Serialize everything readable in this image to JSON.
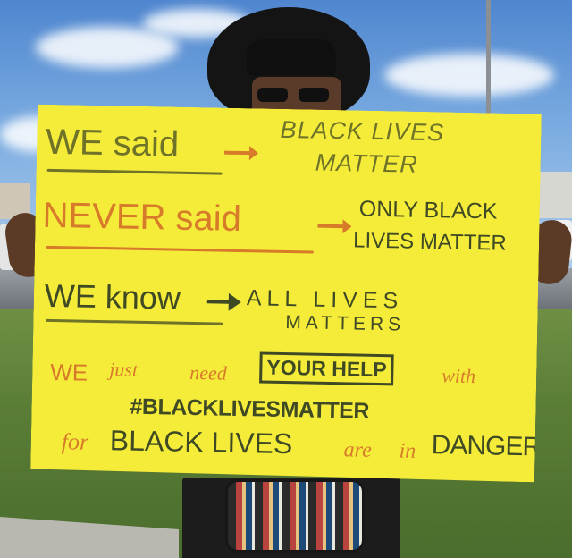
{
  "sign": {
    "line1_left": "WE said",
    "line1_right_1": "BLACK LIVES",
    "line1_right_2": "MATTER",
    "line2_left": "NEVER said",
    "line2_right_1": "ONLY BLACK",
    "line2_right_2": "LIVES MATTER",
    "line3_left": "WE know",
    "line3_right_1": "ALL LIVES",
    "line3_right_2": "MATTERS",
    "line4_a": "WE",
    "line4_b": "just",
    "line4_c": "need",
    "line4_help": "YOUR HELP",
    "line4_d": "with",
    "line5": "#BLACKLIVESMATTER",
    "line6_a": "for",
    "line6_b": "BLACK LIVES",
    "line6_c": "are",
    "line6_d": "in",
    "line6_e": "DANGER"
  },
  "colors": {
    "sign_yellow": "#f5ec3a",
    "olive_ink": "#6f7327",
    "orange_ink": "#d77a2a",
    "dark_ink": "#3f4a24"
  }
}
